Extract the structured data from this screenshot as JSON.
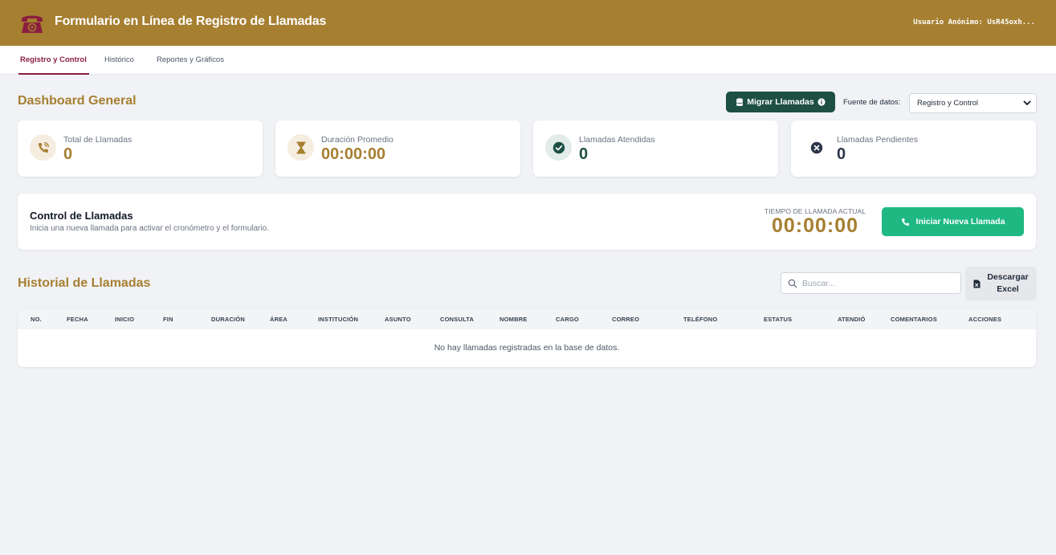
{
  "header": {
    "title": "Formulario en Línea de Registro de Llamadas",
    "user": "Usuario Anónimo: UsR45oxh..."
  },
  "tabs": [
    {
      "label": "Registro y Control",
      "active": true
    },
    {
      "label": "Histórico",
      "active": false
    },
    {
      "label": "Reportes y Gráficos",
      "active": false
    }
  ],
  "dashboard": {
    "title": "Dashboard General",
    "migrate_label": "Migrar Llamadas",
    "datasource_label": "Fuente de datos:",
    "datasource_value": "Registro y Control"
  },
  "stats": [
    {
      "label": "Total de Llamadas",
      "value": "0",
      "icon": "phone-volume-icon"
    },
    {
      "label": "Duración Promedio",
      "value": "00:00:00",
      "icon": "hourglass-icon"
    },
    {
      "label": "Llamadas Atendidas",
      "value": "0",
      "icon": "check-circle-icon"
    },
    {
      "label": "Llamadas Pendientes",
      "value": "0",
      "icon": "x-circle-icon"
    }
  ],
  "control": {
    "title": "Control de Llamadas",
    "subtitle": "Inicia una nueva llamada para activar el cronómetro y el formulario.",
    "timer_label": "TIEMPO DE LLAMADA ACTUAL",
    "timer_value": "00:00:00",
    "start_label": "Iniciar Nueva Llamada"
  },
  "history": {
    "title": "Historial de Llamadas",
    "search_placeholder": "Buscar...",
    "search_value": "",
    "excel_label": "Descargar Excel",
    "columns": [
      "NO.",
      "FECHA",
      "INICIO",
      "FIN",
      "DURACIÓN",
      "ÁREA",
      "INSTITUCIÓN",
      "ASUNTO",
      "CONSULTA",
      "NOMBRE",
      "CARGO",
      "CORREO",
      "TELÉFONO",
      "ESTATUS",
      "ATENDIÓ",
      "COMENTARIOS",
      "ACCIONES"
    ],
    "empty_message": "No hay llamadas registradas en la base de datos."
  },
  "colors": {
    "brand_gold": "#a67f31",
    "accent_maroon": "#8b1e3f",
    "dark_green": "#1d4f43",
    "success_green": "#1fb883",
    "background": "#f1f2f5"
  }
}
